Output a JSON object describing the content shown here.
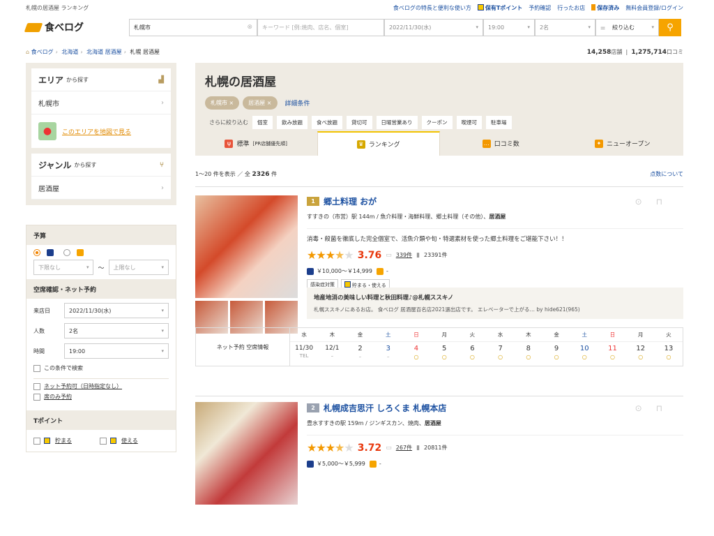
{
  "header": {
    "tagline": "札幌の居酒屋 ランキング",
    "links": [
      "食べログの特長と便利な使い方",
      "保有Tポイント",
      "予約確認",
      "行ったお店",
      "保存済み",
      "無料会員登録/ログイン"
    ],
    "logo_text": "食べログ"
  },
  "search": {
    "area": "札幌市",
    "keyword_placeholder": "キーワード [例:焼肉、店名、個室]",
    "date": "2022/11/30(水)",
    "time": "19:00",
    "people": "2名",
    "refine": "絞り込む"
  },
  "breadcrumb": [
    "食べログ",
    "北海道",
    "北海道 居酒屋",
    "札幌 居酒屋"
  ],
  "counts": {
    "shops": "14,258",
    "shops_unit": "店舗",
    "reviews": "1,275,714",
    "reviews_unit": "口コミ"
  },
  "sidebar": {
    "area_title": "エリア",
    "area_sub": "から探す",
    "area_item": "札幌市",
    "map_link": "このエリアを地図で見る",
    "genre_title": "ジャンル",
    "genre_sub": "から探す",
    "genre_item": "居酒屋"
  },
  "filters": {
    "budget_title": "予算",
    "budget_min": "下限なし",
    "budget_max": "上限なし",
    "tilde": "〜",
    "vacancy_title": "空席確認・ネット予約",
    "date_label": "来店日",
    "date_value": "2022/11/30(水)",
    "people_label": "人数",
    "people_value": "2名",
    "time_label": "時間",
    "time_value": "19:00",
    "search_cond": "この条件で検索",
    "net_reserve": "ネット予約可（日時指定なし）",
    "seat_only": "席のみ予約",
    "tpoint_title": "Tポイント",
    "tpoint_earn": "貯まる",
    "tpoint_use": "使える"
  },
  "main": {
    "title": "札幌の居酒屋",
    "tags": [
      "札幌市 ×",
      "居酒屋 ×"
    ],
    "advanced": "詳細条件",
    "refine_label": "さらに絞り込む",
    "refine_items": [
      "個室",
      "飲み放題",
      "食べ放題",
      "貸切可",
      "日曜営業あり",
      "クーポン",
      "喫煙可",
      "駐車場"
    ],
    "tabs": [
      {
        "label": "標準",
        "sub": "[PR店舗優先順]"
      },
      {
        "label": "ランキング",
        "sub": ""
      },
      {
        "label": "口コミ数",
        "sub": ""
      },
      {
        "label": "ニューオープン",
        "sub": ""
      }
    ],
    "results_text": "1～20 件を表示 ／ 全",
    "results_total": "2326",
    "results_unit": "件",
    "score_about": "点数について"
  },
  "shops": [
    {
      "rank": "1",
      "name": "郷土料理 おが",
      "location": "すすきの（市営）駅 144m / 魚介料理・海鮮料理、郷土料理（その他）、",
      "genre": "居酒屋",
      "catch": "消毒・殺菌を徹底した完全個室で、活魚介類や旬・特選素材を使った郷土料理をご堪能下さい！！",
      "score": "3.76",
      "rating": 3.76,
      "reviews": "339件",
      "saves": "23391件",
      "price": "￥10,000～￥14,999",
      "price_lunch": "-",
      "badges": [
        "感染症対策",
        "貯まる・使える"
      ],
      "review_title": "地産地消の美味しい料理と秋田料理♪@札幌ススキノ",
      "review_text": "札幌ススキノにあるお店。 食べログ 居酒屋百名店2021選出店です。 エレベーターで上がる… by hide621(965)"
    },
    {
      "rank": "2",
      "name": "札幌成吉思汗 しろくま 札幌本店",
      "location": "豊水すすきの駅 159m / ジンギスカン、焼肉、",
      "genre": "居酒屋",
      "score": "3.72",
      "rating": 3.72,
      "reviews": "267件",
      "saves": "20811件",
      "price": "￥5,000～￥5,999",
      "price_lunch": "-"
    }
  ],
  "calendar": {
    "label": "ネット予約 空席情報",
    "days": [
      {
        "w": "水",
        "d": "11/30",
        "s": "TEL"
      },
      {
        "w": "木",
        "d": "12/1",
        "s": "–"
      },
      {
        "w": "金",
        "d": "2",
        "s": "–"
      },
      {
        "w": "土",
        "d": "3",
        "s": "–"
      },
      {
        "w": "日",
        "d": "4",
        "s": "○"
      },
      {
        "w": "月",
        "d": "5",
        "s": "○"
      },
      {
        "w": "火",
        "d": "6",
        "s": "○"
      },
      {
        "w": "水",
        "d": "7",
        "s": "○"
      },
      {
        "w": "木",
        "d": "8",
        "s": "○"
      },
      {
        "w": "金",
        "d": "9",
        "s": "○"
      },
      {
        "w": "土",
        "d": "10",
        "s": "○"
      },
      {
        "w": "日",
        "d": "11",
        "s": "○"
      },
      {
        "w": "月",
        "d": "12",
        "s": "○"
      },
      {
        "w": "火",
        "d": "13",
        "s": "○"
      }
    ]
  }
}
